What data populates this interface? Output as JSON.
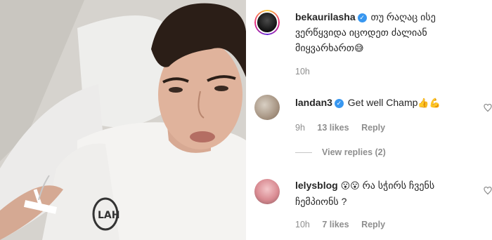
{
  "post": {
    "comments": [
      {
        "username": "bekaurilasha",
        "verified": true,
        "text_line1": "თუ რაღაც ისე",
        "text_line2": "ვერწყვიდა იცოდეთ ძალიან",
        "text_line3": "მიყვარხართ",
        "emoji": "😅",
        "time": "10h"
      },
      {
        "username": "landan3",
        "verified": true,
        "text": "Get well Champ",
        "emoji": "👍💪",
        "time": "9h",
        "likes": "13 likes",
        "reply": "Reply"
      },
      {
        "username": "lelysblog",
        "verified": false,
        "emoji_prefix": "😮😮",
        "text_line1": "რა სჭირს ჩვენს",
        "text_line2": "ჩემპიონს ?",
        "time": "10h",
        "likes": "7 likes",
        "reply": "Reply"
      }
    ],
    "view_replies": "View replies (2)"
  },
  "colors": {
    "verified": "#3897f0",
    "meta": "#8e8e8e",
    "text": "#262626"
  },
  "icons": [
    "verified-badge-icon",
    "heart-icon"
  ]
}
